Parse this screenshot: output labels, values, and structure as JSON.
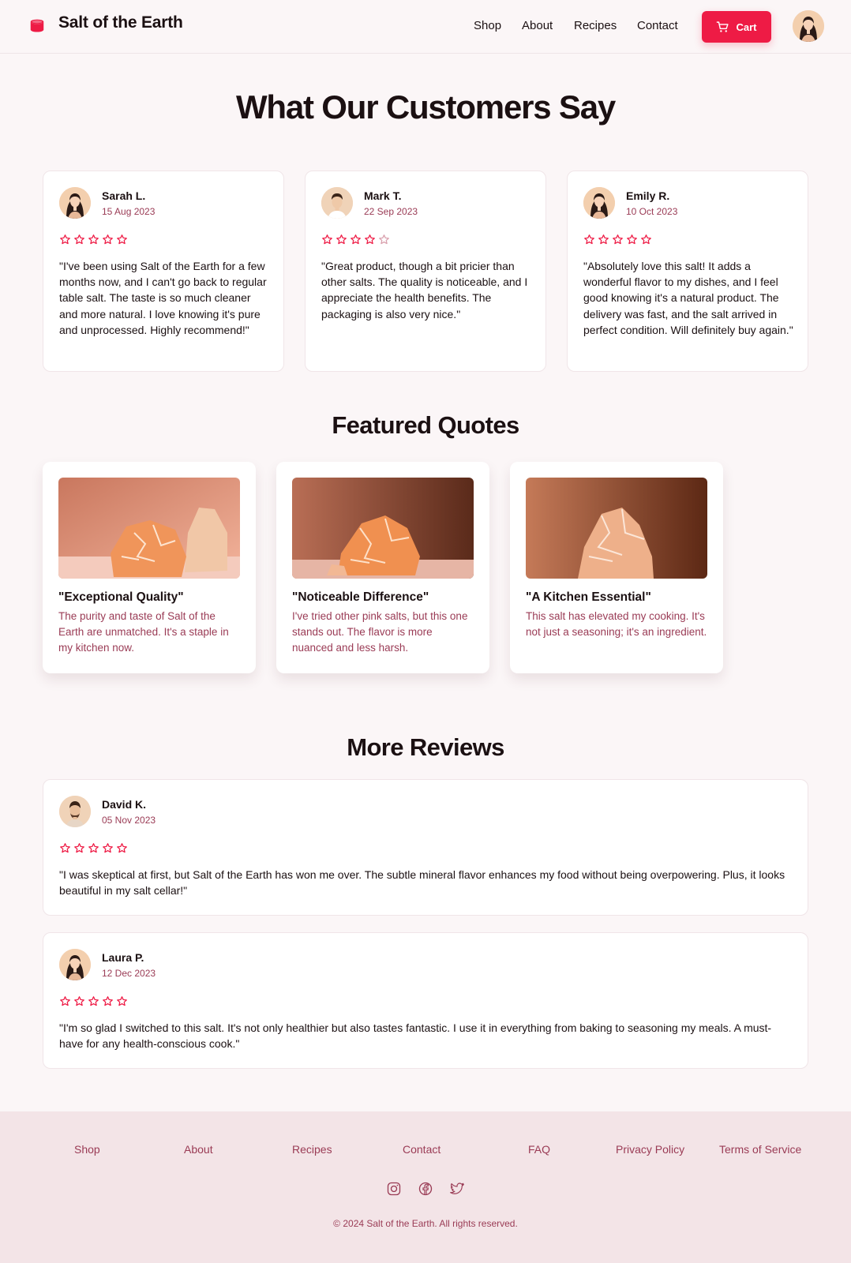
{
  "header": {
    "brand": "Salt of the Earth",
    "nav": [
      "Shop",
      "About",
      "Recipes",
      "Contact"
    ],
    "cart_label": "Cart"
  },
  "testimonials": {
    "heading": "What Our Customers Say",
    "reviews": [
      {
        "name": "Sarah L.",
        "date": "15 Aug 2023",
        "rating": 5,
        "text": "\"I've been using Salt of the Earth for a few months now, and I can't go back to regular table salt. The taste is so much cleaner and more natural. I love knowing it's pure and unprocessed. Highly recommend!\""
      },
      {
        "name": "Mark T.",
        "date": "22 Sep 2023",
        "rating": 4,
        "text": "\"Great product, though a bit pricier than other salts. The quality is noticeable, and I appreciate the health benefits. The packaging is also very nice.\""
      },
      {
        "name": "Emily R.",
        "date": "10 Oct 2023",
        "rating": 5,
        "text": "\"Absolutely love this salt! It adds a wonderful flavor to my dishes, and I feel good knowing it's a natural product. The delivery was fast, and the salt arrived in perfect condition. Will definitely buy again.\""
      }
    ]
  },
  "featured": {
    "heading": "Featured Quotes",
    "quotes": [
      {
        "title": "\"Exceptional Quality\"",
        "text": "The purity and taste of Salt of the Earth are unmatched. It's a staple in my kitchen now."
      },
      {
        "title": "\"Noticeable Difference\"",
        "text": "I've tried other pink salts, but this one stands out. The flavor is more nuanced and less harsh."
      },
      {
        "title": "\"A Kitchen Essential\"",
        "text": "This salt has elevated my cooking. It's not just a seasoning; it's an ingredient."
      }
    ]
  },
  "more": {
    "heading": "More Reviews",
    "reviews": [
      {
        "name": "David K.",
        "date": "05 Nov 2023",
        "rating": 5,
        "text": "\"I was skeptical at first, but Salt of the Earth has won me over. The subtle mineral flavor enhances my food without being overpowering. Plus, it looks beautiful in my salt cellar!\""
      },
      {
        "name": "Laura P.",
        "date": "12 Dec 2023",
        "rating": 5,
        "text": "\"I'm so glad I switched to this salt. It's not only healthier but also tastes fantastic. I use it in everything from baking to seasoning my meals. A must-have for any health-conscious cook.\""
      }
    ]
  },
  "footer": {
    "links": [
      "Shop",
      "About",
      "Recipes",
      "Contact",
      "FAQ",
      "Privacy Policy",
      "Terms of Service"
    ],
    "social": [
      "instagram-icon",
      "facebook-icon",
      "twitter-icon"
    ],
    "copyright": "© 2024 Salt of the Earth. All rights reserved."
  },
  "colors": {
    "accent": "#ee1b45",
    "muted_text": "#9a3b55",
    "background": "#fbf6f7",
    "footer_bg": "#f3e4e7"
  }
}
